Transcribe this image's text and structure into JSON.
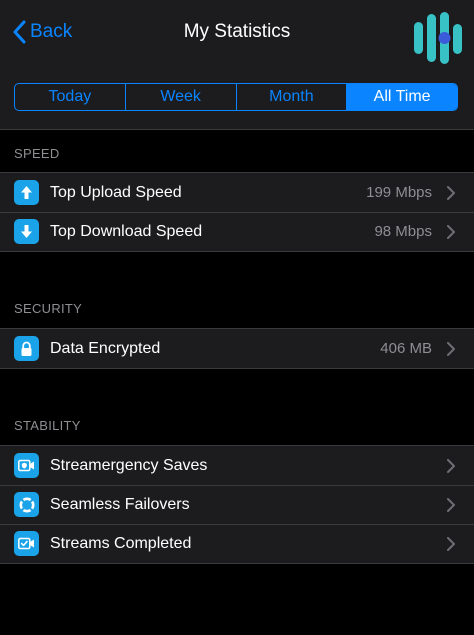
{
  "nav": {
    "back_label": "Back",
    "title": "My Statistics"
  },
  "segments": [
    {
      "label": "Today",
      "active": false
    },
    {
      "label": "Week",
      "active": false
    },
    {
      "label": "Month",
      "active": false
    },
    {
      "label": "All Time",
      "active": true
    }
  ],
  "sections": {
    "speed": {
      "header": "SPEED",
      "rows": [
        {
          "label": "Top Upload Speed",
          "value": "199 Mbps",
          "icon": "upload-arrow-icon"
        },
        {
          "label": "Top Download Speed",
          "value": "98 Mbps",
          "icon": "download-arrow-icon"
        }
      ]
    },
    "security": {
      "header": "SECURITY",
      "rows": [
        {
          "label": "Data Encrypted",
          "value": "406 MB",
          "icon": "lock-icon"
        }
      ]
    },
    "stability": {
      "header": "STABILITY",
      "rows": [
        {
          "label": "Streamergency Saves",
          "value": "",
          "icon": "video-camera-shield-icon"
        },
        {
          "label": "Seamless Failovers",
          "value": "",
          "icon": "lifebuoy-icon"
        },
        {
          "label": "Streams Completed",
          "value": "",
          "icon": "video-camera-check-icon"
        }
      ]
    }
  },
  "colors": {
    "accent": "#0a84ff",
    "icon_bg": "#1aa3e8",
    "logo_teal": "#38c2c6",
    "logo_dot": "#3b5bdb"
  }
}
